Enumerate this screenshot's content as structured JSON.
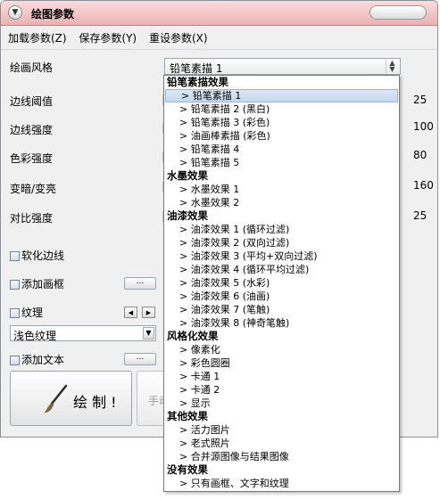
{
  "window": {
    "title": "绘图参数"
  },
  "menu": [
    "加载参数(Z)",
    "保存参数(Y)",
    "重设参数(X)"
  ],
  "params": {
    "style_label": "绘画风格",
    "style_selected": "铅笔素描 1",
    "edge_threshold": {
      "label": "边线阈值",
      "value": "25"
    },
    "edge_strength": {
      "label": "边线强度",
      "value": "100"
    },
    "color_strength": {
      "label": "色彩强度",
      "value": "80"
    },
    "darken_lighten": {
      "label": "变暗/变亮",
      "value": "160"
    },
    "contrast": {
      "label": "对比强度",
      "value": "25"
    }
  },
  "options": {
    "soften_edges": "软化边线",
    "add_frame": "添加画框",
    "texture": "纹理",
    "texture_selected": "浅色纹理",
    "add_text": "添加文本",
    "more_button": "..."
  },
  "buttons": {
    "draw": "绘 制 !",
    "manual": "手动"
  },
  "dropdown": {
    "groups": [
      {
        "name": "铅笔素描效果",
        "items": [
          "铅笔素描 1",
          "铅笔素描 2 (黑白)",
          "铅笔素描 3 (彩色)",
          "油画棒素描 (彩色)",
          "铅笔素描 4",
          "铅笔素描 5"
        ]
      },
      {
        "name": "水墨效果",
        "items": [
          "水墨效果 1",
          "水墨效果 2"
        ]
      },
      {
        "name": "油漆效果",
        "items": [
          "油漆效果 1 (循环过滤)",
          "油漆效果 2 (双向过滤)",
          "油漆效果 3 (平均+双向过滤)",
          "油漆效果 4 (循环平均过滤)",
          "油漆效果 5 (水彩)",
          "油漆效果 6 (油画)",
          "油漆效果 7 (笔触)",
          "油漆效果 8 (神奇笔触)"
        ]
      },
      {
        "name": "风格化效果",
        "items": [
          "像素化",
          "彩色圆圈",
          "卡通 1",
          "卡通 2",
          "显示"
        ]
      },
      {
        "name": "其他效果",
        "items": [
          "活力图片",
          "老式照片",
          "合并源图像与结果图像"
        ]
      },
      {
        "name": "没有效果",
        "items": [
          "只有画框、文字和纹理"
        ]
      }
    ],
    "item_prefix": "> ",
    "selected_item": "铅笔素描 1"
  },
  "colors": {
    "titlebar": "#e9b3b3",
    "selection": "#c4d8ef"
  }
}
